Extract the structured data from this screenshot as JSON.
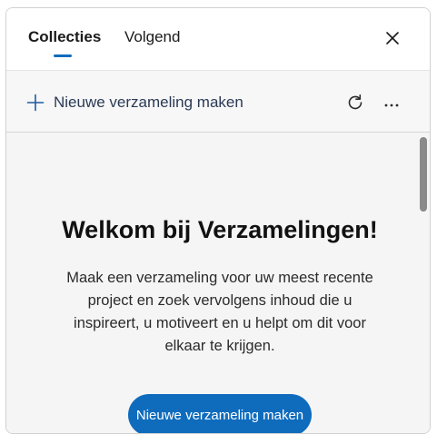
{
  "tabs": [
    {
      "label": "Collecties",
      "active": true
    },
    {
      "label": "Volgend",
      "active": false
    }
  ],
  "toolbar": {
    "new_collection_label": "Nieuwe verzameling maken"
  },
  "welcome": {
    "title": "Welkom bij Verzamelingen!",
    "text": "Maak een verzameling voor uw meest recente project en zoek vervolgens inhoud die u inspireert, u motiveert en u helpt om dit voor elkaar te krijgen.",
    "button_label": "Nieuwe verzameling maken"
  },
  "icons": {
    "close": "close-icon",
    "plus": "plus-icon",
    "refresh": "refresh-icon",
    "more": "more-icon"
  },
  "colors": {
    "accent": "#0f6cbd",
    "link_text": "#2b3a55",
    "button_bg": "#0f6cbd"
  }
}
